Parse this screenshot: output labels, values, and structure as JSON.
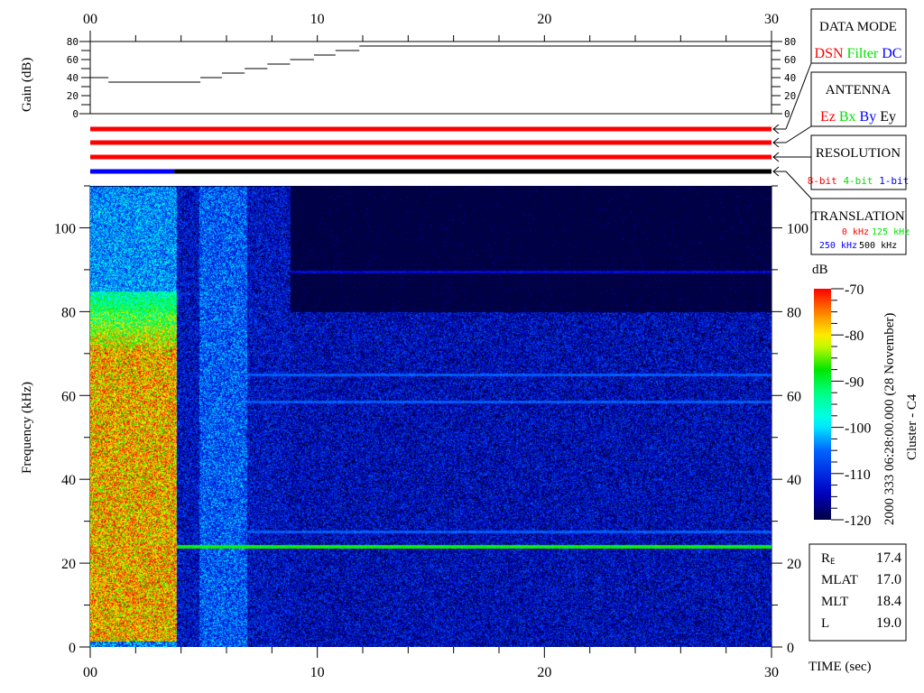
{
  "chart_data": {
    "type": "heatmap",
    "title": "",
    "xlabel": "TIME (sec)",
    "ylabel": "Frequency (kHz)",
    "xlim": [
      0,
      30
    ],
    "ylim": [
      0,
      110
    ],
    "x_tick_labels": [
      "00",
      "10",
      "20",
      "30"
    ],
    "x_tick_values": [
      0,
      10,
      20,
      30
    ],
    "y_tick_values": [
      0,
      20,
      40,
      60,
      80,
      100
    ],
    "y_tick_labels": [
      "0",
      "20",
      "40",
      "60",
      "80",
      "100"
    ],
    "colorbar": {
      "label": "dB",
      "range": [
        -120,
        -70
      ],
      "tick_labels": [
        "-70",
        "-80",
        "-90",
        "-100",
        "-110",
        "-120"
      ],
      "colormap": "jet"
    },
    "regions": [
      {
        "time": [
          0,
          3.8
        ],
        "freq": [
          0,
          85
        ],
        "level_db": -78
      },
      {
        "time": [
          0,
          3.8
        ],
        "freq": [
          85,
          110
        ],
        "level_db": -104
      },
      {
        "time": [
          3.8,
          4.8
        ],
        "freq": [
          0,
          110
        ],
        "level_db": -113
      },
      {
        "time": [
          4.8,
          6.9
        ],
        "freq": [
          0,
          110
        ],
        "level_db": -107
      },
      {
        "time": [
          6.9,
          8.8
        ],
        "freq": [
          0,
          110
        ],
        "level_db": -113
      },
      {
        "time": [
          8.8,
          30
        ],
        "freq": [
          0,
          80
        ],
        "level_db": -114
      },
      {
        "time": [
          8.8,
          30
        ],
        "freq": [
          80,
          110
        ],
        "level_db": -120
      }
    ],
    "narrowband_lines_khz": [
      {
        "freq": 24,
        "time": [
          3.8,
          30
        ],
        "level_db": -88
      },
      {
        "freq": 27.5,
        "time": [
          6.9,
          30
        ],
        "level_db": -106
      },
      {
        "freq": 58.5,
        "time": [
          6.9,
          30
        ],
        "level_db": -106
      },
      {
        "freq": 65,
        "time": [
          6.9,
          30
        ],
        "level_db": -106
      },
      {
        "freq": 89.5,
        "time": [
          8.8,
          30
        ],
        "level_db": -113
      }
    ],
    "gain_panel": {
      "ylabel": "Gain (dB)",
      "ylim": [
        0,
        80
      ],
      "y_tick_labels": [
        "0",
        "20",
        "40",
        "60",
        "80"
      ],
      "steps": [
        {
          "t0": 0,
          "t1": 0.8,
          "gain": 40
        },
        {
          "t0": 0.8,
          "t1": 4.85,
          "gain": 35
        },
        {
          "t0": 4.85,
          "t1": 5.8,
          "gain": 40
        },
        {
          "t0": 5.8,
          "t1": 6.8,
          "gain": 45
        },
        {
          "t0": 6.8,
          "t1": 7.8,
          "gain": 50
        },
        {
          "t0": 7.8,
          "t1": 8.8,
          "gain": 55
        },
        {
          "t0": 8.8,
          "t1": 9.85,
          "gain": 60
        },
        {
          "t0": 9.85,
          "t1": 10.8,
          "gain": 65
        },
        {
          "t0": 10.8,
          "t1": 11.85,
          "gain": 70
        },
        {
          "t0": 11.85,
          "t1": 30,
          "gain": 75
        }
      ]
    },
    "status_bars": [
      {
        "name": "data-mode",
        "segments": [
          {
            "t0": 0,
            "t1": 30,
            "color": "#ff0000"
          }
        ]
      },
      {
        "name": "antenna",
        "segments": [
          {
            "t0": 0,
            "t1": 30,
            "color": "#ff0000"
          }
        ]
      },
      {
        "name": "resolution",
        "segments": [
          {
            "t0": 0,
            "t1": 30,
            "color": "#ff0000"
          }
        ]
      },
      {
        "name": "translation",
        "segments": [
          {
            "t0": 0,
            "t1": 3.7,
            "color": "#0000ff"
          },
          {
            "t0": 3.7,
            "t1": 30,
            "color": "#000000"
          }
        ]
      }
    ]
  },
  "legend": {
    "data_mode": {
      "title": "DATA MODE",
      "items": [
        {
          "label": "DSN",
          "color": "#ff0000"
        },
        {
          "label": "Filter",
          "color": "#00e000"
        },
        {
          "label": "DC",
          "color": "#0000ff"
        }
      ]
    },
    "antenna": {
      "title": "ANTENNA",
      "items": [
        {
          "label": "Ez",
          "color": "#ff0000"
        },
        {
          "label": "Bx",
          "color": "#00e000"
        },
        {
          "label": "By",
          "color": "#0000ff"
        },
        {
          "label": "Ey",
          "color": "#000000"
        }
      ]
    },
    "resolution": {
      "title": "RESOLUTION",
      "items": [
        {
          "label": "8-bit",
          "color": "#ff0000"
        },
        {
          "label": "4-bit",
          "color": "#00e000"
        },
        {
          "label": "1-bit",
          "color": "#0000ff"
        }
      ]
    },
    "translation": {
      "title": "TRANSLATION",
      "items": [
        {
          "label": "0 kHz",
          "color": "#ff0000"
        },
        {
          "label": "125 kHz",
          "color": "#00e000"
        },
        {
          "label": "250 kHz",
          "color": "#0000ff"
        },
        {
          "label": "500 kHz",
          "color": "#000000"
        }
      ]
    }
  },
  "timestamp": "2000 333 06:28:00.000 (28 November)",
  "spacecraft": "Cluster - C4",
  "orbit_info": [
    {
      "label": "R",
      "sub": "E",
      "value": "17.4"
    },
    {
      "label": "MLAT",
      "sub": "",
      "value": "17.0"
    },
    {
      "label": "MLT",
      "sub": "",
      "value": "18.4"
    },
    {
      "label": "L",
      "sub": "",
      "value": "19.0"
    }
  ]
}
